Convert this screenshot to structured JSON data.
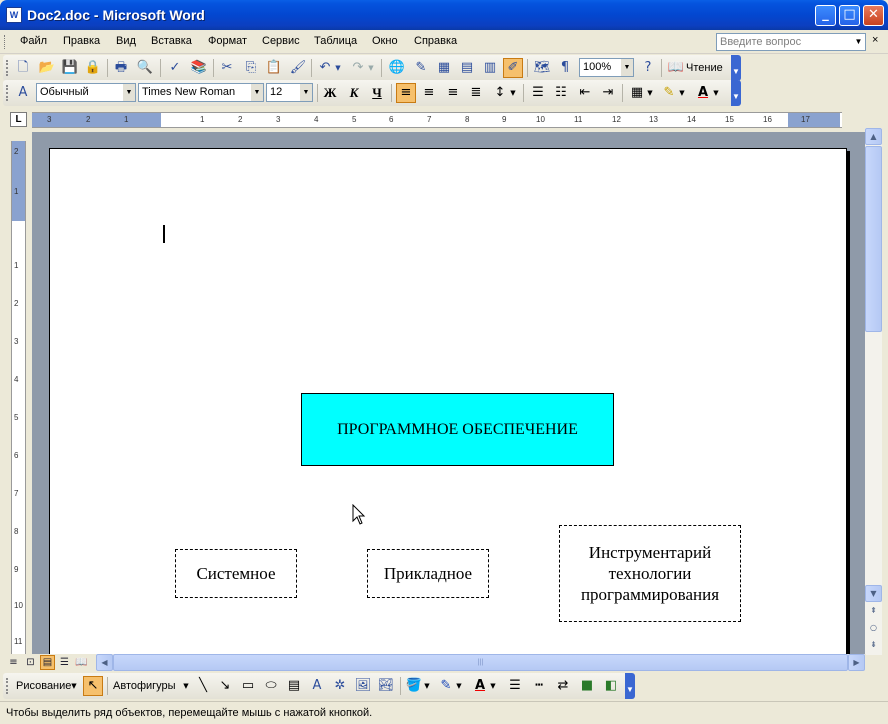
{
  "window": {
    "title": "Doc2.doc - Microsoft Word",
    "app_icon": "W"
  },
  "menu": {
    "items": [
      "Файл",
      "Правка",
      "Вид",
      "Вставка",
      "Формат",
      "Сервис",
      "Таблица",
      "Окно",
      "Справка"
    ],
    "help_placeholder": "Введите вопрос",
    "close_glyph": "×"
  },
  "toolbar_standard": {
    "zoom": "100%",
    "read_label": "Чтение"
  },
  "toolbar_format": {
    "style": "Обычный",
    "font": "Times New Roman",
    "size": "12",
    "bold": "Ж",
    "italic": "К",
    "underline": "Ч"
  },
  "ruler": {
    "corner": "L",
    "h_labels": [
      "3",
      "2",
      "1",
      "1",
      "2",
      "3",
      "4",
      "5",
      "6",
      "7",
      "8",
      "9",
      "10",
      "11",
      "12",
      "13",
      "14",
      "15",
      "16",
      "17"
    ],
    "v_labels": [
      "2",
      "1",
      "1",
      "2",
      "3",
      "4",
      "5",
      "6",
      "7",
      "8",
      "9",
      "10",
      "11"
    ]
  },
  "document": {
    "main_box": "ПРОГРАММНОЕ ОБЕСПЕЧЕНИЕ",
    "box_system": "Системное",
    "box_applied": "Прикладное",
    "box_tools_lines": [
      "Инструментарий",
      "технологии",
      "программирования"
    ],
    "main_box_color": "#00ffff"
  },
  "drawing_toolbar": {
    "draw_label": "Рисование",
    "autoshapes_label": "Автофигуры"
  },
  "status": {
    "text": "Чтобы выделить ряд объектов, перемещайте мышь с нажатой кнопкой."
  }
}
